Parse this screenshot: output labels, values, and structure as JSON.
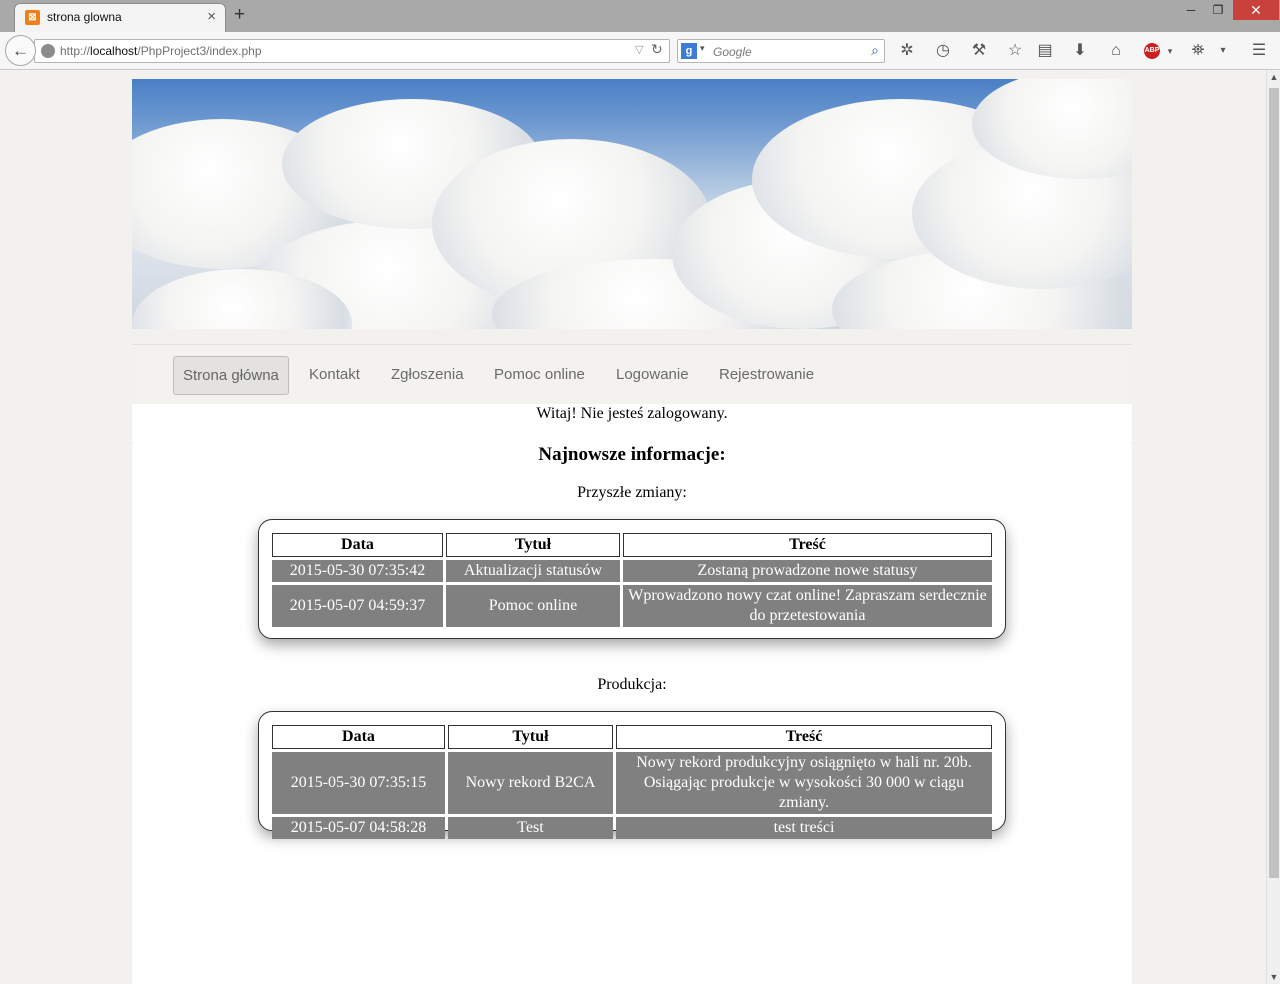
{
  "browser": {
    "tab_title": "strona glowna",
    "tab_icon": "xampp-icon",
    "url_prefix": "http://",
    "url_host": "localhost",
    "url_path": "/PhpProject3/index.php",
    "search_placeholder": "Google",
    "abp_label": "ABP"
  },
  "menu": {
    "items": [
      {
        "label": "Strona główna"
      },
      {
        "label": "Kontakt"
      },
      {
        "label": "Zgłoszenia"
      },
      {
        "label": "Pomoc online"
      },
      {
        "label": "Logowanie"
      },
      {
        "label": "Rejestrowanie"
      }
    ]
  },
  "welcome": "Witaj! Nie jesteś zalogowany.",
  "main": {
    "heading": "Najnowsze informacje:",
    "sections": [
      {
        "title": "Przyszłe zmiany:",
        "headers": [
          "Data",
          "Tytuł",
          "Treść"
        ],
        "rows": [
          [
            "2015-05-30 07:35:42",
            "Aktualizacji statusów",
            "Zostaną prowadzone nowe statusy"
          ],
          [
            "2015-05-07 04:59:37",
            "Pomoc online",
            "Wprowadzono nowy czat online! Zapraszam serdecznie do przetestowania"
          ]
        ]
      },
      {
        "title": "Produkcja:",
        "headers": [
          "Data",
          "Tytuł",
          "Treść"
        ],
        "rows": [
          [
            "2015-05-30 07:35:15",
            "Nowy rekord B2CA",
            "Nowy rekord produkcyjny osiągnięto w hali nr. 20b. Osiągając produkcje w wysokości 30 000 w ciągu zmiany."
          ],
          [
            "2015-05-07 04:58:28",
            "Test",
            "test treści"
          ]
        ]
      }
    ]
  }
}
